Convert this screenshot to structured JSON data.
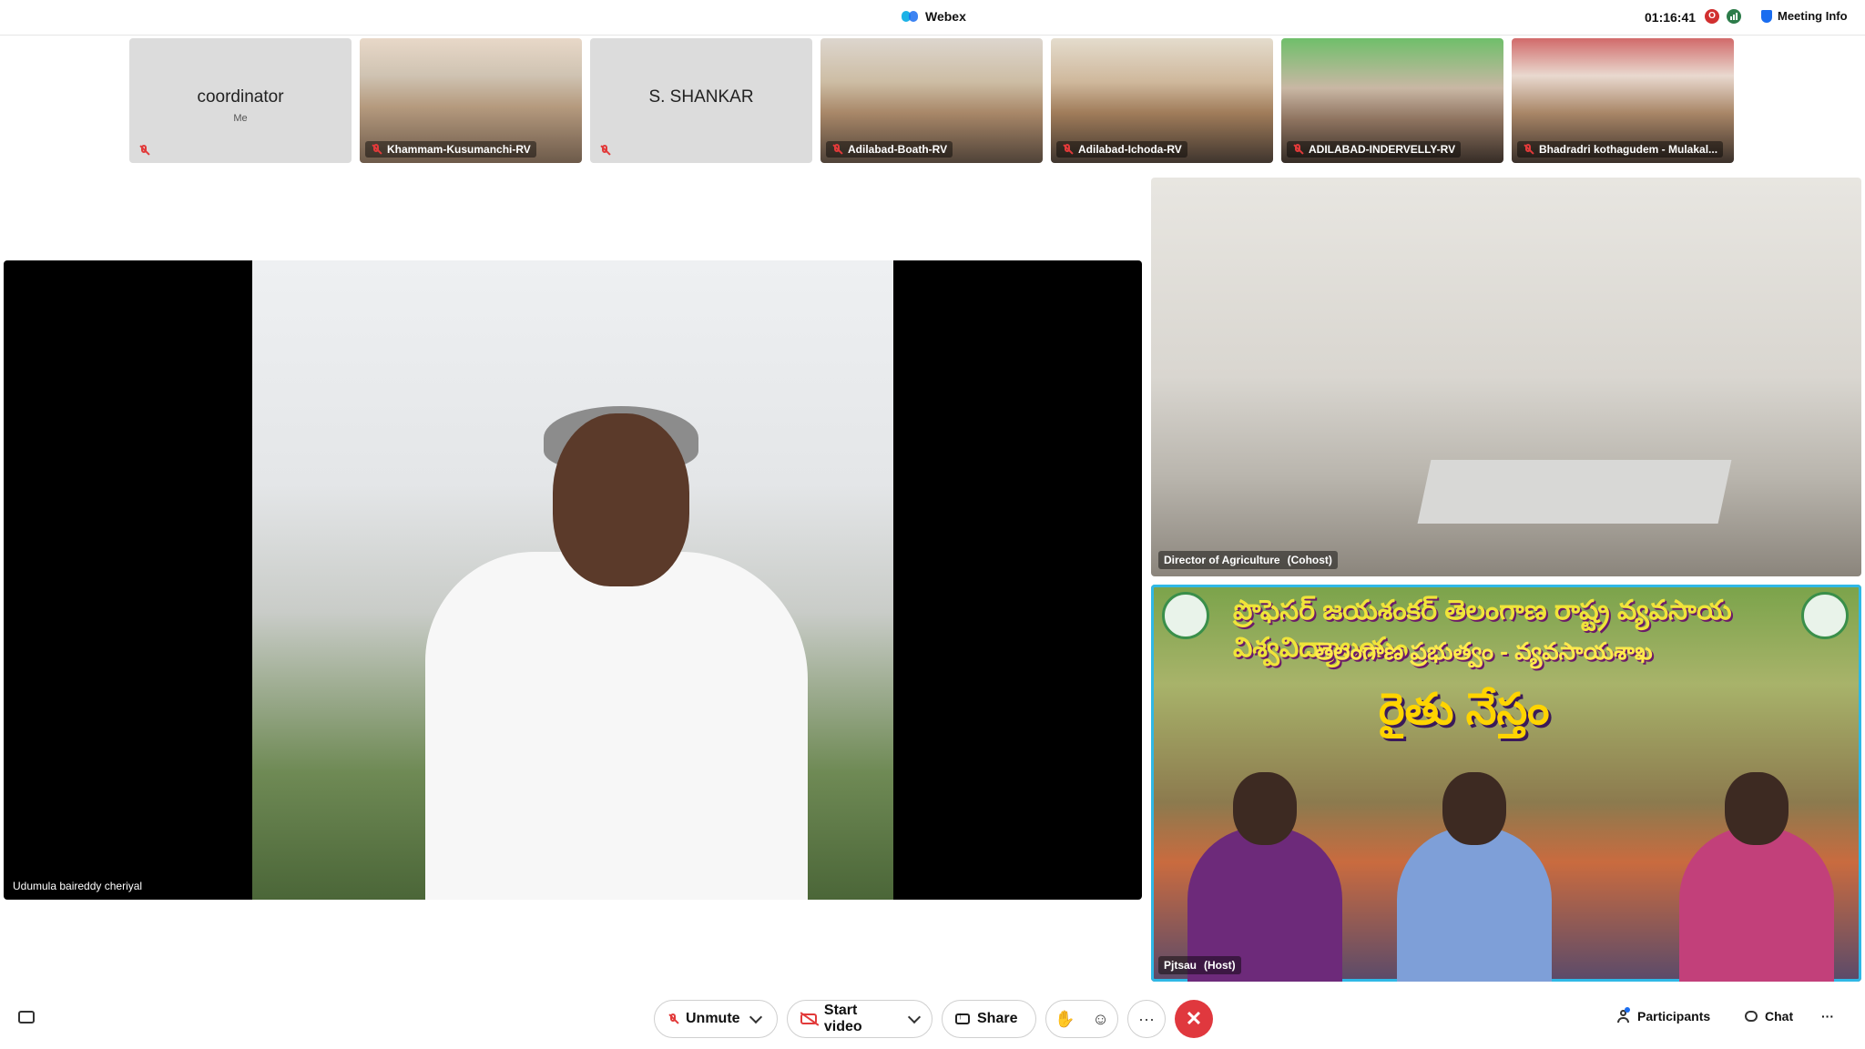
{
  "topbar": {
    "app_title": "Webex",
    "timer": "01:16:41",
    "rec_label": "O",
    "meeting_info": "Meeting Info"
  },
  "strip": [
    {
      "name": "coordinator",
      "sub": "Me",
      "muted": true
    },
    {
      "name": "Khammam-Kusumanchi-RV",
      "muted": true
    },
    {
      "name": "S. SHANKAR",
      "muted": true
    },
    {
      "name": "Adilabad-Boath-RV",
      "muted": true
    },
    {
      "name": "Adilabad-Ichoda-RV",
      "muted": true
    },
    {
      "name": "ADILABAD-INDERVELLY-RV",
      "muted": true
    },
    {
      "name": "Bhadradri kothagudem - Mulakal...",
      "muted": true
    }
  ],
  "main_video": {
    "name": "Udumula baireddy cheriyal"
  },
  "right_videos": [
    {
      "name": "Director of Agriculture",
      "role": "(Cohost)"
    },
    {
      "name": "Pjtsau",
      "role": "(Host)",
      "banner": {
        "line1": "ప్రొఫెసర్ జయశంకర్ తెలంగాణ రాష్ట్ర వ్యవసాయ విశ్వవిద్యాలయం",
        "line2": "తెలంగాణ ప్రభుత్వం - వ్యవసాయశాఖ",
        "line3": "రైతు నేస్తం"
      }
    }
  ],
  "controls": {
    "unmute": "Unmute",
    "start_video": "Start video",
    "share": "Share",
    "raise_hand_icon": "✋",
    "reactions_icon": "☺",
    "more": "···",
    "end_icon": "✕",
    "participants": "Participants",
    "chat": "Chat",
    "overflow": "···"
  },
  "colors": {
    "mute_red": "#e23a3a",
    "end_red": "#e0383e",
    "active_speaker_border": "#2fb8e6",
    "accent_blue": "#1a6df0"
  }
}
